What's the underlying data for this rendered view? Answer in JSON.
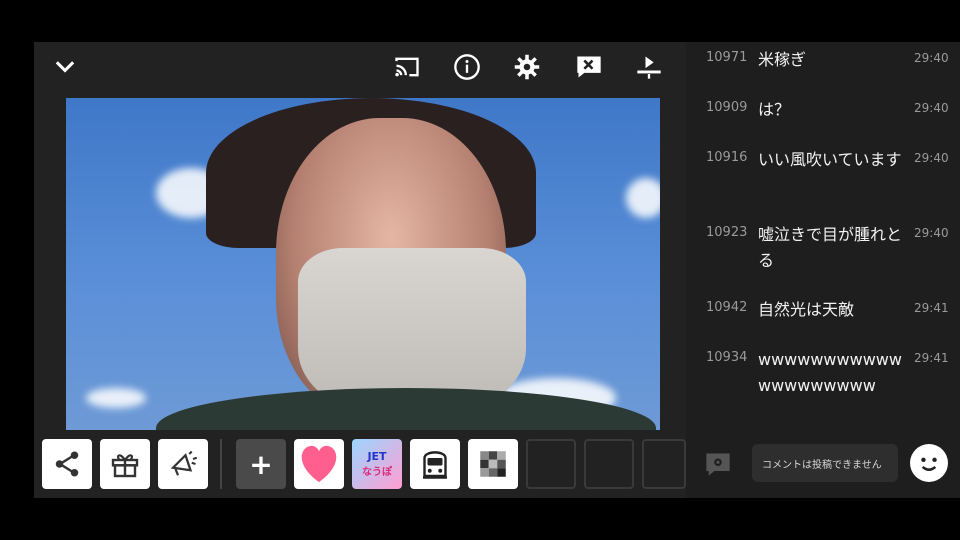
{
  "toolbar": {
    "icons": [
      "chevron-down-icon",
      "cast-icon",
      "info-icon",
      "settings-icon",
      "close-comments-icon",
      "download-icon"
    ]
  },
  "bottom_tools": {
    "plus_label": "+",
    "jet_label": "JET",
    "jet_sub": "なうぽ"
  },
  "chat": {
    "messages": [
      {
        "num": "10971",
        "text": "米稼ぎ",
        "time": "29:40"
      },
      {
        "num": "10909",
        "text": "は？",
        "time": "29:40"
      },
      {
        "num": "10916",
        "text": "いい風吹いています",
        "time": "29:40"
      },
      {
        "num": "10923",
        "text": "嘘泣きで目が腫れとる",
        "time": "29:40"
      },
      {
        "num": "10942",
        "text": "自然光は天敵",
        "time": "29:41"
      },
      {
        "num": "10934",
        "text": "wwwwwwwwwwwwwwwwwwww",
        "time": "29:41"
      }
    ],
    "input_placeholder": "コメントは投稿できません"
  },
  "colors": {
    "background": "#000000",
    "panel": "#1e1e1e",
    "heart": "#ff5f8f"
  }
}
